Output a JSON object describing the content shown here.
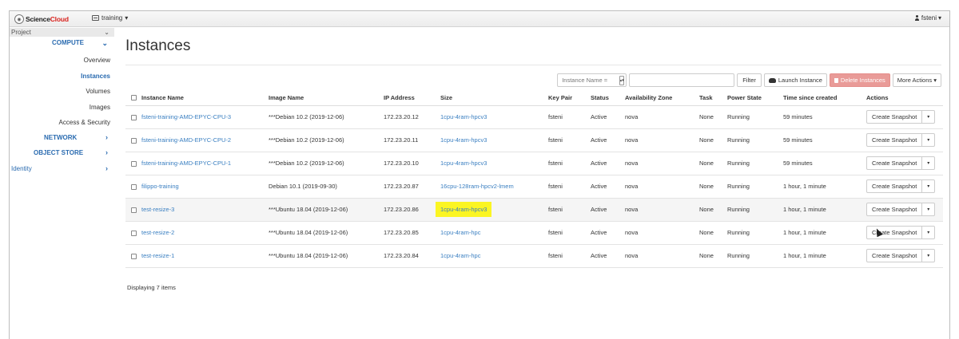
{
  "navbar": {
    "logo_text_a": "Science",
    "logo_text_b": "Cloud",
    "project": "training",
    "user": "fsteni",
    "caret": "▾"
  },
  "sidebar": {
    "project_label": "Project",
    "compute": "COMPUTE",
    "overview": "Overview",
    "instances": "Instances",
    "volumes": "Volumes",
    "images": "Images",
    "access_security": "Access & Security",
    "network": "NETWORK",
    "object_store": "OBJECT STORE",
    "identity": "Identity",
    "chev_down": "⌄",
    "chev_right": "›"
  },
  "page": {
    "title": "Instances",
    "footer": "Displaying 7 items"
  },
  "toolbar": {
    "filter_select": "Instance Name =",
    "filter_input": "",
    "filter_button": "Filter",
    "launch": "Launch Instance",
    "delete": "Delete Instances",
    "more": "More Actions ▾"
  },
  "table": {
    "headers": {
      "name": "Instance Name",
      "image": "Image Name",
      "ip": "IP Address",
      "size": "Size",
      "key": "Key Pair",
      "status": "Status",
      "zone": "Availability Zone",
      "task": "Task",
      "power": "Power State",
      "time": "Time since created",
      "actions": "Actions"
    },
    "action_label": "Create Snapshot",
    "action_caret": "▾",
    "rows": [
      {
        "name": "fsteni-training-AMD-EPYC-CPU-3",
        "image": "***Debian 10.2 (2019-12-06)",
        "ip": "172.23.20.12",
        "size": "1cpu-4ram-hpcv3",
        "key": "fsteni",
        "status": "Active",
        "zone": "nova",
        "task": "None",
        "power": "Running",
        "time": "59 minutes"
      },
      {
        "name": "fsteni-training-AMD-EPYC-CPU-2",
        "image": "***Debian 10.2 (2019-12-06)",
        "ip": "172.23.20.11",
        "size": "1cpu-4ram-hpcv3",
        "key": "fsteni",
        "status": "Active",
        "zone": "nova",
        "task": "None",
        "power": "Running",
        "time": "59 minutes"
      },
      {
        "name": "fsteni-training-AMD-EPYC-CPU-1",
        "image": "***Debian 10.2 (2019-12-06)",
        "ip": "172.23.20.10",
        "size": "1cpu-4ram-hpcv3",
        "key": "fsteni",
        "status": "Active",
        "zone": "nova",
        "task": "None",
        "power": "Running",
        "time": "59 minutes"
      },
      {
        "name": "filippo-training",
        "image": "Debian 10.1 (2019-09-30)",
        "ip": "172.23.20.87",
        "size": "16cpu-128ram-hpcv2-lmem",
        "key": "fsteni",
        "status": "Active",
        "zone": "nova",
        "task": "None",
        "power": "Running",
        "time": "1 hour, 1 minute"
      },
      {
        "name": "test-resize-3",
        "image": "***Ubuntu 18.04 (2019-12-06)",
        "ip": "172.23.20.86",
        "size": "1cpu-4ram-hpcv3",
        "key": "fsteni",
        "status": "Active",
        "zone": "nova",
        "task": "None",
        "power": "Running",
        "time": "1 hour, 1 minute"
      },
      {
        "name": "test-resize-2",
        "image": "***Ubuntu 18.04 (2019-12-06)",
        "ip": "172.23.20.85",
        "size": "1cpu-4ram-hpc",
        "key": "fsteni",
        "status": "Active",
        "zone": "nova",
        "task": "None",
        "power": "Running",
        "time": "1 hour, 1 minute"
      },
      {
        "name": "test-resize-1",
        "image": "***Ubuntu 18.04 (2019-12-06)",
        "ip": "172.23.20.84",
        "size": "1cpu-4ram-hpc",
        "key": "fsteni",
        "status": "Active",
        "zone": "nova",
        "task": "None",
        "power": "Running",
        "time": "1 hour, 1 minute"
      }
    ]
  },
  "colors": {
    "link": "#3a7fc1",
    "brand_red": "#d9241f",
    "delete_button": "#e99b98",
    "highlight": "#fbf523"
  }
}
